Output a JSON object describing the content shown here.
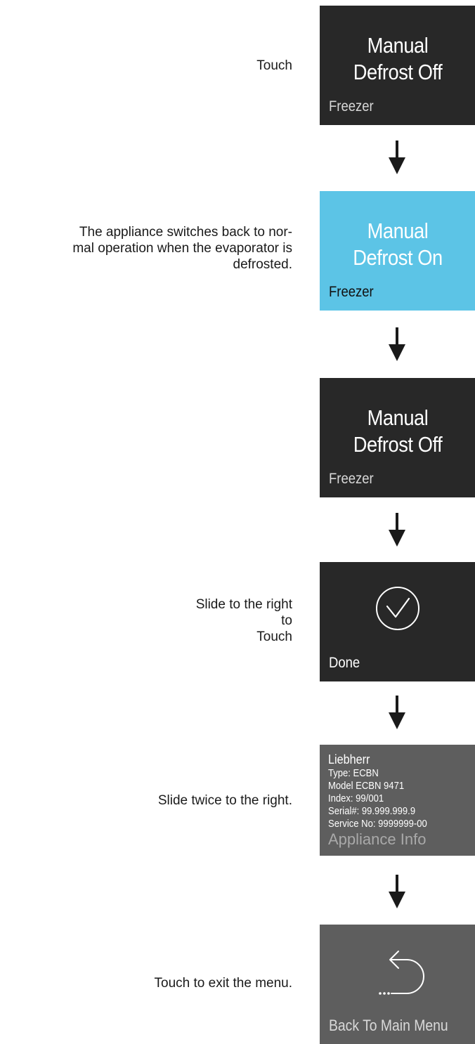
{
  "steps": [
    {
      "instruction": "Touch",
      "tile": {
        "line1": "Manual",
        "line2": "Defrost Off",
        "sub": "Freezer"
      }
    },
    {
      "instruction": "The appliance switches back to normal operation when the evaporator is defrosted.",
      "instruction_lines": [
        "The appliance switches back to nor-",
        "mal operation when the evaporator is",
        "defrosted."
      ],
      "tile": {
        "line1": "Manual",
        "line2": "Defrost On",
        "sub": "Freezer"
      }
    },
    {
      "instruction": "",
      "tile": {
        "line1": "Manual",
        "line2": "Defrost Off",
        "sub": "Freezer"
      }
    },
    {
      "instruction_lines": [
        "Slide to the right",
        "to",
        "Touch"
      ],
      "tile": {
        "icon": "checkmark-circle-icon",
        "sub": "Done"
      }
    },
    {
      "instruction": "Slide twice to the right.",
      "tile": {
        "lines": [
          "Liebherr",
          "Type: ECBN",
          "Model ECBN 9471",
          "Index: 99/001",
          "Serial#: 99.999.999.9",
          "Service No: 9999999-00"
        ],
        "caption": "Appliance Info"
      }
    },
    {
      "instruction": "Touch to exit the menu.",
      "tile": {
        "icon": "back-arrow-icon",
        "sub": "Back To Main Menu"
      }
    }
  ],
  "colors": {
    "tile_dark": "#282828",
    "tile_active": "#5cc4e6",
    "tile_gray": "#5e5e5e",
    "arrow": "#1a1a1a"
  }
}
